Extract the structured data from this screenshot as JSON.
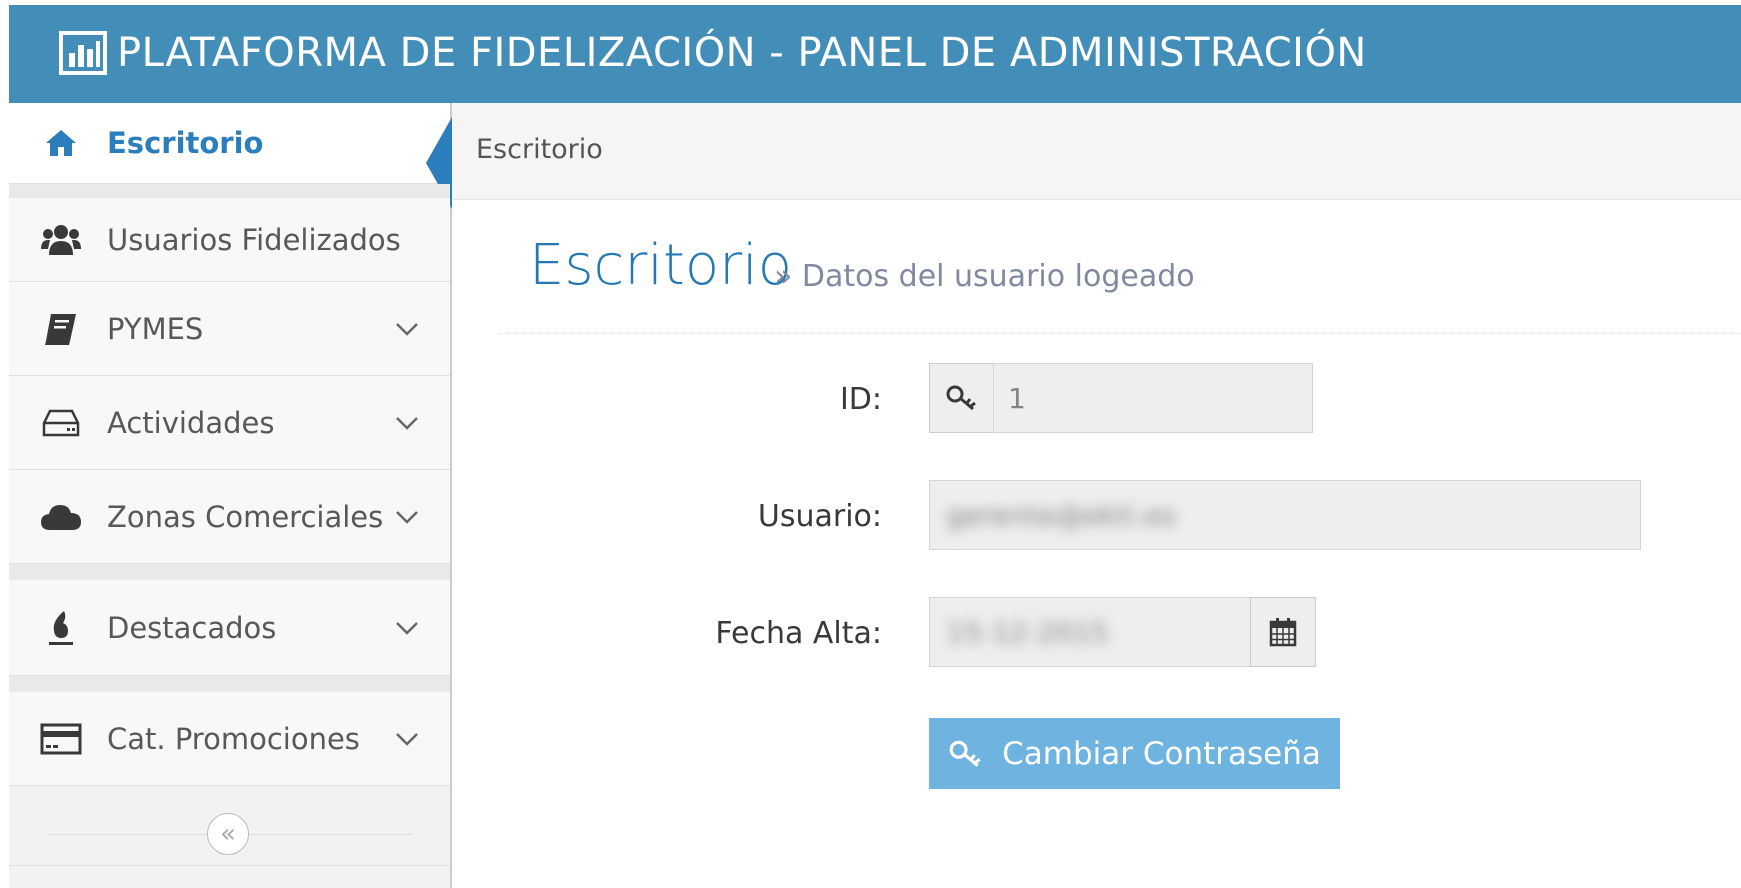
{
  "header": {
    "title": "PLATAFORMA DE FIDELIZACIÓN - PANEL DE ADMINISTRACIÓN",
    "icon": "bar-chart-icon"
  },
  "sidebar": {
    "items": [
      {
        "label": "Escritorio",
        "icon": "home-icon",
        "active": true
      },
      {
        "label": "Usuarios Fidelizados",
        "icon": "users-icon"
      },
      {
        "label": "PYMES",
        "icon": "book-icon",
        "has_submenu": true
      },
      {
        "label": "Actividades",
        "icon": "hdd-icon",
        "has_submenu": true
      },
      {
        "label": "Zonas Comerciales",
        "icon": "cloud-icon",
        "has_submenu": true
      },
      {
        "label": "Destacados",
        "icon": "fire-icon",
        "has_submenu": true
      },
      {
        "label": "Cat. Promociones",
        "icon": "credit-card-icon",
        "has_submenu": true
      }
    ],
    "collapse_symbol": "«"
  },
  "breadcrumb": {
    "current": "Escritorio"
  },
  "page": {
    "title": "Escritorio",
    "subtitle": "» Datos del usuario logeado"
  },
  "form": {
    "id_label": "ID:",
    "id_value": "1",
    "user_label": "Usuario:",
    "user_value": "gerente@ekti.es",
    "date_label": "Fecha Alta:",
    "date_value": "15-12-2015",
    "change_password_label": "Cambiar Contraseña"
  },
  "colors": {
    "navbar": "#438eb9",
    "accent": "#2b7dbc",
    "button": "#6fb3e0"
  }
}
